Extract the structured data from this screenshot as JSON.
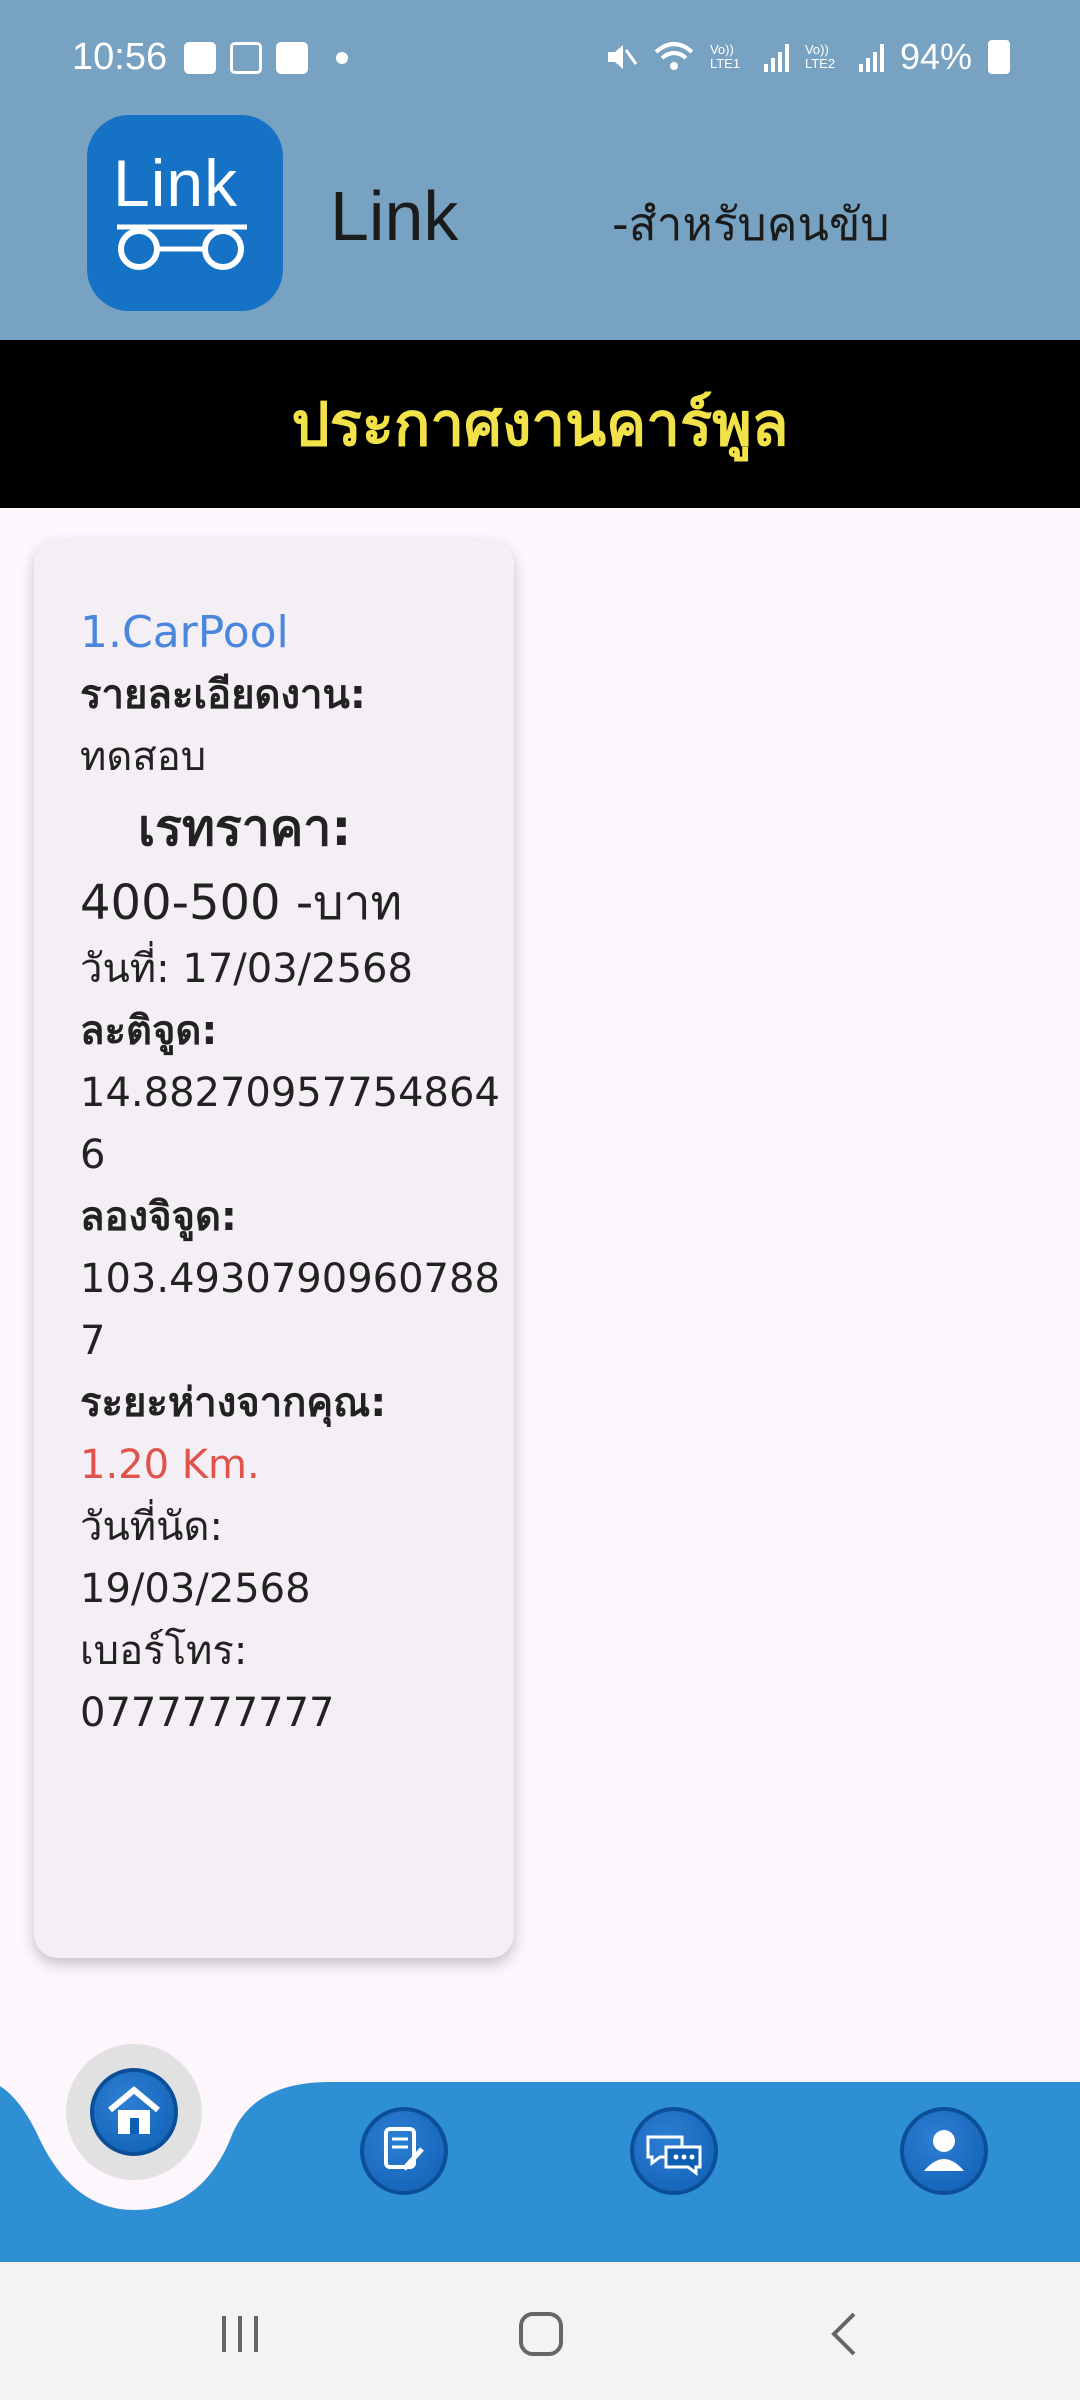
{
  "status_bar": {
    "time": "10:56",
    "battery": "94%",
    "network_labels": [
      "Vo)) LTE1",
      "Vo)) LTE2"
    ]
  },
  "header": {
    "logo_text": "Link",
    "app_name": "Link",
    "subtitle": "-สำหรับคนขับ"
  },
  "banner": {
    "title": "ประกาศงานคาร์พูล"
  },
  "card": {
    "title": "1.CarPool",
    "detail_label": "รายละเอียดงาน:",
    "detail_value": "ทดสอบ",
    "price_label": "เรทราคา:",
    "price_value": "400-500 -บาท",
    "date_text": "วันที่: 17/03/2568",
    "lat_label": "ละติจูด:",
    "lat_value": "14.882709577548646",
    "lng_label": "ลองจิจูด:",
    "lng_value": "103.49307909607887",
    "distance_label": "ระยะห่างจากคุณ:",
    "distance_value": "1.20 Km.",
    "appointment_label": "วันที่นัด:",
    "appointment_value": "19/03/2568",
    "phone_label": "เบอร์โทร:",
    "phone_value": "0777777777"
  },
  "bottom_nav": {
    "items": [
      {
        "icon": "home-icon",
        "active": true
      },
      {
        "icon": "edit-note-icon",
        "active": false
      },
      {
        "icon": "chat-icon",
        "active": false
      },
      {
        "icon": "user-icon",
        "active": false
      }
    ],
    "colors": {
      "bar": "#2f8fd4",
      "active_bg": "#e1e1e1"
    }
  },
  "system_nav": {
    "icons": [
      "recent-apps-icon",
      "home-circle-icon",
      "back-icon"
    ]
  },
  "colors": {
    "header_bg": "#77a2c2",
    "banner_bg": "#000000",
    "banner_text": "#f2e24a",
    "card_title": "#4a86dc",
    "distance_text": "#e0524a",
    "page_bg": "#fdf6fc"
  }
}
